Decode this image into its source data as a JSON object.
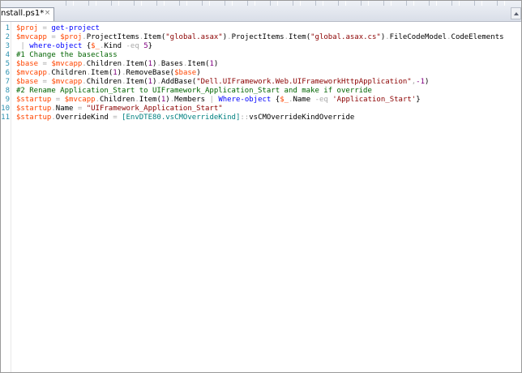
{
  "tab": {
    "label": "nstall.ps1*",
    "close_glyph": "×",
    "close_icon": "close-icon"
  },
  "line_numbers": [
    "1",
    "2",
    "3",
    "4",
    "5",
    "6",
    "7",
    "8",
    "9",
    "10",
    "11"
  ],
  "code": [
    [
      {
        "t": "var",
        "v": "$proj"
      },
      {
        "t": "pln",
        "v": " "
      },
      {
        "t": "op",
        "v": "="
      },
      {
        "t": "pln",
        "v": " "
      },
      {
        "t": "cmd",
        "v": "get-project"
      }
    ],
    [
      {
        "t": "var",
        "v": "$mvcapp"
      },
      {
        "t": "pln",
        "v": " "
      },
      {
        "t": "op",
        "v": "="
      },
      {
        "t": "pln",
        "v": " "
      },
      {
        "t": "var",
        "v": "$proj"
      },
      {
        "t": "op",
        "v": "."
      },
      {
        "t": "pln",
        "v": "ProjectItems"
      },
      {
        "t": "op",
        "v": "."
      },
      {
        "t": "pln",
        "v": "Item("
      },
      {
        "t": "str",
        "v": "\"global.asax\""
      },
      {
        "t": "pln",
        "v": ")"
      },
      {
        "t": "op",
        "v": "."
      },
      {
        "t": "pln",
        "v": "ProjectItems"
      },
      {
        "t": "op",
        "v": "."
      },
      {
        "t": "pln",
        "v": "Item("
      },
      {
        "t": "str",
        "v": "\"global.asax.cs\""
      },
      {
        "t": "pln",
        "v": ")"
      },
      {
        "t": "op",
        "v": "."
      },
      {
        "t": "pln",
        "v": "FileCodeModel"
      },
      {
        "t": "op",
        "v": "."
      },
      {
        "t": "pln",
        "v": "CodeElements"
      }
    ],
    [
      {
        "t": "pln",
        "v": " "
      },
      {
        "t": "op",
        "v": "|"
      },
      {
        "t": "pln",
        "v": " "
      },
      {
        "t": "cmd",
        "v": "where-object"
      },
      {
        "t": "pln",
        "v": " {"
      },
      {
        "t": "var",
        "v": "$_"
      },
      {
        "t": "op",
        "v": "."
      },
      {
        "t": "pln",
        "v": "Kind "
      },
      {
        "t": "op",
        "v": "-eq"
      },
      {
        "t": "pln",
        "v": " "
      },
      {
        "t": "num",
        "v": "5"
      },
      {
        "t": "pln",
        "v": "}"
      }
    ],
    [
      {
        "t": "com",
        "v": "#1 Change the baseclass"
      }
    ],
    [
      {
        "t": "var",
        "v": "$base"
      },
      {
        "t": "pln",
        "v": " "
      },
      {
        "t": "op",
        "v": "="
      },
      {
        "t": "pln",
        "v": " "
      },
      {
        "t": "var",
        "v": "$mvcapp"
      },
      {
        "t": "op",
        "v": "."
      },
      {
        "t": "pln",
        "v": "Children"
      },
      {
        "t": "op",
        "v": "."
      },
      {
        "t": "pln",
        "v": "Item("
      },
      {
        "t": "num",
        "v": "1"
      },
      {
        "t": "pln",
        "v": ")"
      },
      {
        "t": "op",
        "v": "."
      },
      {
        "t": "pln",
        "v": "Bases"
      },
      {
        "t": "op",
        "v": "."
      },
      {
        "t": "pln",
        "v": "Item("
      },
      {
        "t": "num",
        "v": "1"
      },
      {
        "t": "pln",
        "v": ")"
      }
    ],
    [
      {
        "t": "var",
        "v": "$mvcapp"
      },
      {
        "t": "op",
        "v": "."
      },
      {
        "t": "pln",
        "v": "Children"
      },
      {
        "t": "op",
        "v": "."
      },
      {
        "t": "pln",
        "v": "Item("
      },
      {
        "t": "num",
        "v": "1"
      },
      {
        "t": "pln",
        "v": ")"
      },
      {
        "t": "op",
        "v": "."
      },
      {
        "t": "pln",
        "v": "RemoveBase("
      },
      {
        "t": "var",
        "v": "$base"
      },
      {
        "t": "pln",
        "v": ")"
      }
    ],
    [
      {
        "t": "var",
        "v": "$base"
      },
      {
        "t": "pln",
        "v": " "
      },
      {
        "t": "op",
        "v": "="
      },
      {
        "t": "pln",
        "v": " "
      },
      {
        "t": "var",
        "v": "$mvcapp"
      },
      {
        "t": "op",
        "v": "."
      },
      {
        "t": "pln",
        "v": "Children"
      },
      {
        "t": "op",
        "v": "."
      },
      {
        "t": "pln",
        "v": "Item("
      },
      {
        "t": "num",
        "v": "1"
      },
      {
        "t": "pln",
        "v": ")"
      },
      {
        "t": "op",
        "v": "."
      },
      {
        "t": "pln",
        "v": "AddBase("
      },
      {
        "t": "str",
        "v": "\"Dell.UIFramework.Web.UIFrameworkHttpApplication\""
      },
      {
        "t": "op",
        "v": ","
      },
      {
        "t": "num",
        "v": "-1"
      },
      {
        "t": "pln",
        "v": ")"
      }
    ],
    [
      {
        "t": "com",
        "v": "#2 Rename Application_Start to UIFramework_Application_Start and make if override"
      }
    ],
    [
      {
        "t": "var",
        "v": "$startup"
      },
      {
        "t": "pln",
        "v": " "
      },
      {
        "t": "op",
        "v": "="
      },
      {
        "t": "pln",
        "v": " "
      },
      {
        "t": "var",
        "v": "$mvcapp"
      },
      {
        "t": "op",
        "v": "."
      },
      {
        "t": "pln",
        "v": "Children"
      },
      {
        "t": "op",
        "v": "."
      },
      {
        "t": "pln",
        "v": "Item("
      },
      {
        "t": "num",
        "v": "1"
      },
      {
        "t": "pln",
        "v": ")"
      },
      {
        "t": "op",
        "v": "."
      },
      {
        "t": "pln",
        "v": "Members "
      },
      {
        "t": "op",
        "v": "|"
      },
      {
        "t": "pln",
        "v": " "
      },
      {
        "t": "cmd",
        "v": "Where-object"
      },
      {
        "t": "pln",
        "v": " {"
      },
      {
        "t": "var",
        "v": "$_"
      },
      {
        "t": "op",
        "v": "."
      },
      {
        "t": "pln",
        "v": "Name "
      },
      {
        "t": "op",
        "v": "-eq"
      },
      {
        "t": "pln",
        "v": " "
      },
      {
        "t": "str",
        "v": "'Application_Start'"
      },
      {
        "t": "pln",
        "v": "}"
      }
    ],
    [
      {
        "t": "var",
        "v": "$startup"
      },
      {
        "t": "op",
        "v": "."
      },
      {
        "t": "pln",
        "v": "Name "
      },
      {
        "t": "op",
        "v": "="
      },
      {
        "t": "pln",
        "v": " "
      },
      {
        "t": "str",
        "v": "\"UIFramework_Application_Start\""
      }
    ],
    [
      {
        "t": "var",
        "v": "$startup"
      },
      {
        "t": "op",
        "v": "."
      },
      {
        "t": "pln",
        "v": "OverrideKind "
      },
      {
        "t": "op",
        "v": "="
      },
      {
        "t": "pln",
        "v": " "
      },
      {
        "t": "type",
        "v": "[EnvDTE80.vsCMOverrideKind]"
      },
      {
        "t": "op",
        "v": "::"
      },
      {
        "t": "pln",
        "v": "vsCMOverrideKindOverride"
      }
    ]
  ],
  "colors": {
    "variable": "#ff4500",
    "command": "#0000ff",
    "string": "#8b0000",
    "comment": "#006400",
    "operator": "#a9a9a9",
    "type": "#008080",
    "number": "#800080",
    "line_number": "#2b91af"
  }
}
